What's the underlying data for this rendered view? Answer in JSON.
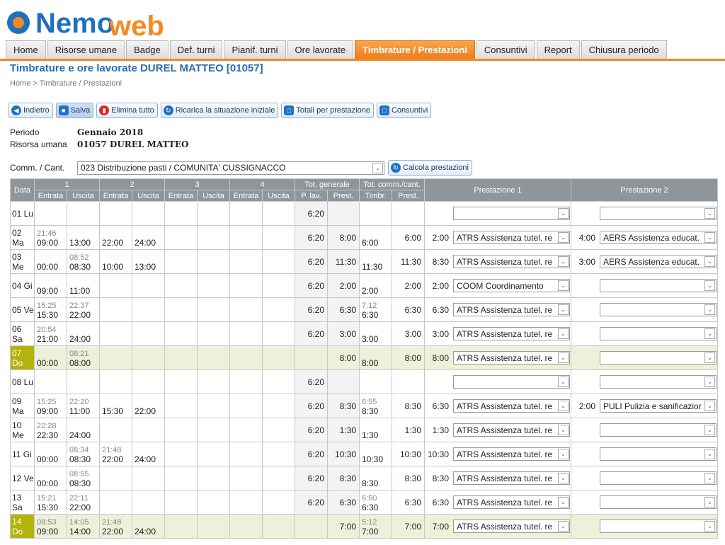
{
  "app": {
    "logo_text": "NemoWeb"
  },
  "nav": {
    "tabs": [
      "Home",
      "Risorse umane",
      "Badge",
      "Def. turni",
      "Pianif. turni",
      "Ore lavorate",
      "Timbrature / Prestazioni",
      "Consuntivi",
      "Report",
      "Chiusura periodo"
    ],
    "active": "Timbrature / Prestazioni"
  },
  "page": {
    "title": "Timbrature e ore lavorate DUREL MATTEO [01057]",
    "breadcrumb": "Home > Timbrature / Prestazioni"
  },
  "toolbar": {
    "back": "Indietro",
    "save": "Salva",
    "delete_all": "Elimina tutto",
    "reload": "Ricarica la situazione iniziale",
    "totals": "Totali per prestazione",
    "consuntivi": "Consuntivi"
  },
  "info": {
    "periodo_label": "Periodo",
    "periodo_value": "Gennaio 2018",
    "risorsa_label": "Risorsa umana",
    "risorsa_value": "01057 DUREL MATTEO",
    "comm_label": "Comm. / Cant.",
    "comm_value": "023 Distribuzione pasti / COMUNITA' CUSSIGNACCO",
    "calc_button": "Calcola prestazioni"
  },
  "table": {
    "headers": {
      "data": "Data",
      "groups": [
        "1",
        "2",
        "3",
        "4"
      ],
      "entrata": "Entrata",
      "uscita": "Uscita",
      "tot_generale": "Tot. generale",
      "tot_comm": "Tot. comm./cant.",
      "plav": "P. lav.",
      "prest": "Prest.",
      "timbr": "Timbr.",
      "prest1": "Prestazione 1",
      "prest2": "Prestazione 2"
    },
    "rows": [
      {
        "day": "01 Lu",
        "we": false,
        "c": [
          [
            "",
            ""
          ],
          [
            "",
            ""
          ],
          [
            "",
            ""
          ],
          [
            "",
            ""
          ],
          [
            "",
            ""
          ],
          [
            "",
            ""
          ],
          [
            "",
            ""
          ],
          [
            "",
            ""
          ]
        ],
        "plav": "6:20",
        "prest": "",
        "timbr": [
          "",
          ""
        ],
        "cprest": "",
        "p1h": "",
        "p1": "",
        "p2h": "",
        "p2": ""
      },
      {
        "day": "02 Ma",
        "we": false,
        "c": [
          [
            "21:46",
            "09:00"
          ],
          [
            "",
            "13:00"
          ],
          [
            "",
            "22:00"
          ],
          [
            "",
            "24:00"
          ],
          [
            "",
            ""
          ],
          [
            "",
            ""
          ],
          [
            "",
            ""
          ],
          [
            "",
            ""
          ]
        ],
        "plav": "6:20",
        "prest": "8:00",
        "timbr": [
          "",
          "6:00"
        ],
        "cprest": "6:00",
        "p1h": "2:00",
        "p1": "ATRS Assistenza tutel. re",
        "p2h": "4:00",
        "p2": "AERS Assistenza educat."
      },
      {
        "day": "03 Me",
        "we": false,
        "c": [
          [
            "",
            "00:00"
          ],
          [
            "08:52",
            "08:30"
          ],
          [
            "",
            "10:00"
          ],
          [
            "",
            "13:00"
          ],
          [
            "",
            ""
          ],
          [
            "",
            ""
          ],
          [
            "",
            ""
          ],
          [
            "",
            ""
          ]
        ],
        "plav": "6:20",
        "prest": "11:30",
        "timbr": [
          "",
          "11:30"
        ],
        "cprest": "11:30",
        "p1h": "8:30",
        "p1": "ATRS Assistenza tutel. re",
        "p2h": "3:00",
        "p2": "AERS Assistenza educat."
      },
      {
        "day": "04 Gi",
        "we": false,
        "c": [
          [
            "",
            "09:00"
          ],
          [
            "",
            "11:00"
          ],
          [
            "",
            ""
          ],
          [
            "",
            ""
          ],
          [
            "",
            ""
          ],
          [
            "",
            ""
          ],
          [
            "",
            ""
          ],
          [
            "",
            ""
          ]
        ],
        "plav": "6:20",
        "prest": "2:00",
        "timbr": [
          "",
          "2:00"
        ],
        "cprest": "2:00",
        "p1h": "2:00",
        "p1": "COOM Coordinamento",
        "p2h": "",
        "p2": ""
      },
      {
        "day": "05 Ve",
        "we": false,
        "c": [
          [
            "15:25",
            "15:30"
          ],
          [
            "22:37",
            "22:00"
          ],
          [
            "",
            ""
          ],
          [
            "",
            ""
          ],
          [
            "",
            ""
          ],
          [
            "",
            ""
          ],
          [
            "",
            ""
          ],
          [
            "",
            ""
          ]
        ],
        "plav": "6:20",
        "prest": "6:30",
        "timbr": [
          "7:12",
          "6:30"
        ],
        "cprest": "6:30",
        "p1h": "6:30",
        "p1": "ATRS Assistenza tutel. re",
        "p2h": "",
        "p2": ""
      },
      {
        "day": "06 Sa",
        "we": false,
        "c": [
          [
            "20:54",
            "21:00"
          ],
          [
            "",
            "24:00"
          ],
          [
            "",
            ""
          ],
          [
            "",
            ""
          ],
          [
            "",
            ""
          ],
          [
            "",
            ""
          ],
          [
            "",
            ""
          ],
          [
            "",
            ""
          ]
        ],
        "plav": "6:20",
        "prest": "3:00",
        "timbr": [
          "",
          "3:00"
        ],
        "cprest": "3:00",
        "p1h": "3:00",
        "p1": "ATRS Assistenza tutel. re",
        "p2h": "",
        "p2": ""
      },
      {
        "day": "07 Do",
        "we": true,
        "c": [
          [
            "",
            "00:00"
          ],
          [
            "08:21",
            "08:00"
          ],
          [
            "",
            ""
          ],
          [
            "",
            ""
          ],
          [
            "",
            ""
          ],
          [
            "",
            ""
          ],
          [
            "",
            ""
          ],
          [
            "",
            ""
          ]
        ],
        "plav": "",
        "prest": "8:00",
        "timbr": [
          "",
          "8:00"
        ],
        "cprest": "8:00",
        "p1h": "8:00",
        "p1": "ATRS Assistenza tutel. re",
        "p2h": "",
        "p2": ""
      },
      {
        "day": "08 Lu",
        "we": false,
        "c": [
          [
            "",
            ""
          ],
          [
            "",
            ""
          ],
          [
            "",
            ""
          ],
          [
            "",
            ""
          ],
          [
            "",
            ""
          ],
          [
            "",
            ""
          ],
          [
            "",
            ""
          ],
          [
            "",
            ""
          ]
        ],
        "plav": "6:20",
        "prest": "",
        "timbr": [
          "",
          ""
        ],
        "cprest": "",
        "p1h": "",
        "p1": "",
        "p2h": "",
        "p2": ""
      },
      {
        "day": "09 Ma",
        "we": false,
        "c": [
          [
            "15:25",
            "09:00"
          ],
          [
            "22:20",
            "11:00"
          ],
          [
            "",
            "15:30"
          ],
          [
            "",
            "22:00"
          ],
          [
            "",
            ""
          ],
          [
            "",
            ""
          ],
          [
            "",
            ""
          ],
          [
            "",
            ""
          ]
        ],
        "plav": "6:20",
        "prest": "8:30",
        "timbr": [
          "6:55",
          "8:30"
        ],
        "cprest": "8:30",
        "p1h": "6:30",
        "p1": "ATRS Assistenza tutel. re",
        "p2h": "2:00",
        "p2": "PULI Pulizia e sanificazior"
      },
      {
        "day": "10 Me",
        "we": false,
        "c": [
          [
            "22:28",
            "22:30"
          ],
          [
            "",
            "24:00"
          ],
          [
            "",
            ""
          ],
          [
            "",
            ""
          ],
          [
            "",
            ""
          ],
          [
            "",
            ""
          ],
          [
            "",
            ""
          ],
          [
            "",
            ""
          ]
        ],
        "plav": "6:20",
        "prest": "1:30",
        "timbr": [
          "",
          "1:30"
        ],
        "cprest": "1:30",
        "p1h": "1:30",
        "p1": "ATRS Assistenza tutel. re",
        "p2h": "",
        "p2": ""
      },
      {
        "day": "11 Gi",
        "we": false,
        "c": [
          [
            "",
            "00:00"
          ],
          [
            "08:34",
            "08:30"
          ],
          [
            "21:48",
            "22:00"
          ],
          [
            "",
            "24:00"
          ],
          [
            "",
            ""
          ],
          [
            "",
            ""
          ],
          [
            "",
            ""
          ],
          [
            "",
            ""
          ]
        ],
        "plav": "6:20",
        "prest": "10:30",
        "timbr": [
          "",
          "10:30"
        ],
        "cprest": "10:30",
        "p1h": "10:30",
        "p1": "ATRS Assistenza tutel. re",
        "p2h": "",
        "p2": ""
      },
      {
        "day": "12 Ve",
        "we": false,
        "c": [
          [
            "",
            "00:00"
          ],
          [
            "08:55",
            "08:30"
          ],
          [
            "",
            ""
          ],
          [
            "",
            ""
          ],
          [
            "",
            ""
          ],
          [
            "",
            ""
          ],
          [
            "",
            ""
          ],
          [
            "",
            ""
          ]
        ],
        "plav": "6:20",
        "prest": "8:30",
        "timbr": [
          "",
          "8:30"
        ],
        "cprest": "8:30",
        "p1h": "8:30",
        "p1": "ATRS Assistenza tutel. re",
        "p2h": "",
        "p2": ""
      },
      {
        "day": "13 Sa",
        "we": false,
        "c": [
          [
            "15:21",
            "15:30"
          ],
          [
            "22:11",
            "22:00"
          ],
          [
            "",
            ""
          ],
          [
            "",
            ""
          ],
          [
            "",
            ""
          ],
          [
            "",
            ""
          ],
          [
            "",
            ""
          ],
          [
            "",
            ""
          ]
        ],
        "plav": "6:20",
        "prest": "6:30",
        "timbr": [
          "6:50",
          "6:30"
        ],
        "cprest": "6:30",
        "p1h": "6:30",
        "p1": "ATRS Assistenza tutel. re",
        "p2h": "",
        "p2": ""
      },
      {
        "day": "14 Do",
        "we": true,
        "c": [
          [
            "08:53",
            "09:00"
          ],
          [
            "14:05",
            "14:00"
          ],
          [
            "21:48",
            "22:00"
          ],
          [
            "",
            "24:00"
          ],
          [
            "",
            ""
          ],
          [
            "",
            ""
          ],
          [
            "",
            ""
          ],
          [
            "",
            ""
          ]
        ],
        "plav": "",
        "prest": "7:00",
        "timbr": [
          "5:12",
          "7:00"
        ],
        "cprest": "7:00",
        "p1h": "7:00",
        "p1": "ATRS Assistenza tutel. re",
        "p2h": "",
        "p2": ""
      }
    ]
  }
}
